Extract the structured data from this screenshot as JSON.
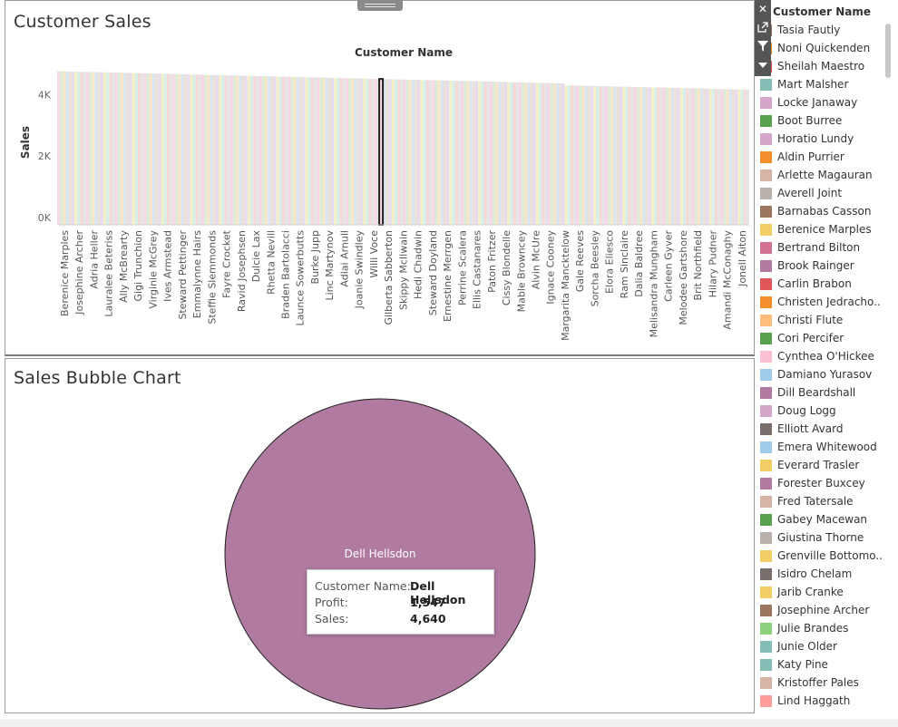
{
  "top_sheet": {
    "title": "Customer Sales"
  },
  "bottom_sheet": {
    "title": "Sales Bubble Chart",
    "bubble": {
      "label": "Dell Hellsdon",
      "color": "#b07aa1"
    },
    "tooltip": {
      "rows": [
        {
          "label": "Customer Name:",
          "value": "Dell Hellsdon"
        },
        {
          "label": "Profit:",
          "value": "1,547"
        },
        {
          "label": "Sales:",
          "value": "4,640"
        }
      ]
    }
  },
  "legend": {
    "title": "Customer Name",
    "items": [
      {
        "label": "Tasia Fautly",
        "color": "#9c755f"
      },
      {
        "label": "Noni Quickenden",
        "color": "#f28e2b"
      },
      {
        "label": "Sheilah Maestro",
        "color": "#e15759"
      },
      {
        "label": "Mart Malsher",
        "color": "#86bcb6"
      },
      {
        "label": "Locke Janaway",
        "color": "#d4a6c8"
      },
      {
        "label": "Boot Burree",
        "color": "#59a14f"
      },
      {
        "label": "Horatio Lundy",
        "color": "#d4a6c8"
      },
      {
        "label": "Aldin Purrier",
        "color": "#f28e2b"
      },
      {
        "label": "Arlette Magauran",
        "color": "#d7b5a6"
      },
      {
        "label": "Averell Joint",
        "color": "#bab0ac"
      },
      {
        "label": "Barnabas Casson",
        "color": "#9c755f"
      },
      {
        "label": "Berenice Marples",
        "color": "#f1ce63"
      },
      {
        "label": "Bertrand Bilton",
        "color": "#d37295"
      },
      {
        "label": "Brook Rainger",
        "color": "#b07aa1"
      },
      {
        "label": "Carlin Brabon",
        "color": "#e15759"
      },
      {
        "label": "Christen Jedracho..",
        "color": "#f28e2b"
      },
      {
        "label": "Christi Flute",
        "color": "#ffbe7d"
      },
      {
        "label": "Cori Percifer",
        "color": "#59a14f"
      },
      {
        "label": "Cynthea O'Hickee",
        "color": "#fabfd2"
      },
      {
        "label": "Damiano Yurasov",
        "color": "#a0cbe8"
      },
      {
        "label": "Dill Beardshall",
        "color": "#b07aa1"
      },
      {
        "label": "Doug Logg",
        "color": "#d4a6c8"
      },
      {
        "label": "Elliott Avard",
        "color": "#79706e"
      },
      {
        "label": "Emera Whitewood",
        "color": "#a0cbe8"
      },
      {
        "label": "Everard Trasler",
        "color": "#f1ce63"
      },
      {
        "label": "Forester Buxcey",
        "color": "#b07aa1"
      },
      {
        "label": "Fred Tatersale",
        "color": "#d7b5a6"
      },
      {
        "label": "Gabey Macewan",
        "color": "#59a14f"
      },
      {
        "label": "Giustina Thorne",
        "color": "#bab0ac"
      },
      {
        "label": "Grenville Bottomo..",
        "color": "#f1ce63"
      },
      {
        "label": "Isidro Chelam",
        "color": "#79706e"
      },
      {
        "label": "Jarib Cranke",
        "color": "#f1ce63"
      },
      {
        "label": "Josephine Archer",
        "color": "#9c755f"
      },
      {
        "label": "Julie Brandes",
        "color": "#8cd17d"
      },
      {
        "label": "Junie Older",
        "color": "#86bcb6"
      },
      {
        "label": "Katy Pine",
        "color": "#86bcb6"
      },
      {
        "label": "Kristoffer Pales",
        "color": "#d7b5a6"
      },
      {
        "label": "Lind Haggath",
        "color": "#ff9d9a"
      }
    ]
  },
  "chart_data": [
    {
      "type": "bar",
      "title": "",
      "header": "Customer Name",
      "xlabel": "",
      "ylabel": "Sales",
      "ylim": [
        0,
        5400
      ],
      "yticks": [
        {
          "value": 0,
          "label": "0K"
        },
        {
          "value": 2000,
          "label": "2K"
        },
        {
          "value": 4000,
          "label": "4K"
        }
      ],
      "grid": false,
      "bar_count": 240,
      "values_approx_max": 5000,
      "values_approx_min": 4460,
      "highlighted_category": "Gilberta Sabberton",
      "categories": [
        "Berenice Marples",
        "Josephine Archer",
        "Adria Heller",
        "Lauralee Beteriss",
        "Ally McBrearty",
        "Gigi Trunchion",
        "Virginie McGrey",
        "Ives Armstead",
        "Steward Pettinger",
        "Emmalynne Hairs",
        "Steffie Slemmonds",
        "Fayre Crocket",
        "Ravid Josephsen",
        "Dulcie Lax",
        "Rhetta Nevill",
        "Braden Bartolacci",
        "Launce Sowerbutts",
        "Burke Jupp",
        "Linc Martynov",
        "Adlai Arnull",
        "Joanie Swindley",
        "Willi Voce",
        "Gilberta Sabberton",
        "Skippy McIlwain",
        "Hedi Chadwin",
        "Steward Doyland",
        "Ernestine Merrgen",
        "Perrine Scalera",
        "Ellis Castanares",
        "Paton Fritzer",
        "Cissy Blondelle",
        "Mable Browncey",
        "Alvin McUre",
        "Ignace Cooney",
        "Margarita Mancktelow",
        "Gale Reeves",
        "Sorcha Beesley",
        "Elora Eliesco",
        "Ram Sinclaire",
        "Dalia Baldree",
        "Melisandra Mungham",
        "Carleen Gyver",
        "Melodee Gartshore",
        "Brit Northfield",
        "Hilary Pudner",
        "Amandi McConaghy",
        "Jonell Aiton"
      ]
    },
    {
      "type": "scatter",
      "title": "Sales Bubble Chart",
      "points": [
        {
          "label": "Dell Hellsdon",
          "profit": 1547,
          "sales": 4640
        }
      ]
    }
  ]
}
